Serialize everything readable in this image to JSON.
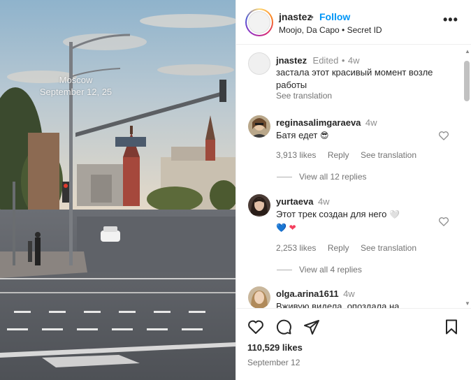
{
  "media": {
    "overlay_city": "Moscow",
    "overlay_date": "September 12, 25"
  },
  "post_header": {
    "username": "jnastez",
    "separator": "•",
    "follow_label": "Follow",
    "subtitle": "Moojo, Da Capo • Secret ID",
    "more_icon": "more-horizontal-icon"
  },
  "caption": {
    "username": "jnastez",
    "edited": "Edited",
    "separator": "•",
    "time": "4w",
    "text_line1": "застала этот красивый момент возле",
    "text_line2": "работы",
    "see_translation": "See translation"
  },
  "comments": [
    {
      "username": "reginasalimgaraeva",
      "time": "4w",
      "text": "Батя едет",
      "emoji": "😎",
      "likes": "3,913 likes",
      "reply": "Reply",
      "see_translation": "See translation",
      "view_replies": "View all 12 replies"
    },
    {
      "username": "yurtaeva",
      "time": "4w",
      "text": "Этот трек создан для него",
      "emoji_line1": "🤍",
      "emoji_line2a": "💙",
      "emoji_line2b": "❤",
      "likes": "2,253 likes",
      "reply": "Reply",
      "see_translation": "See translation",
      "view_replies": "View all 4 replies"
    },
    {
      "username": "olga.arina1611",
      "time": "4w",
      "text": "Вживую видела, опоздала на"
    }
  ],
  "footer": {
    "likes": "110,529 likes",
    "date": "September 12"
  },
  "colors": {
    "accent": "#0095f6",
    "text": "#262626",
    "muted": "#737373",
    "heart_blue": "#3b82f6",
    "heart_red": "#f43f5e",
    "heart_lavender": "#d8cdf7"
  }
}
